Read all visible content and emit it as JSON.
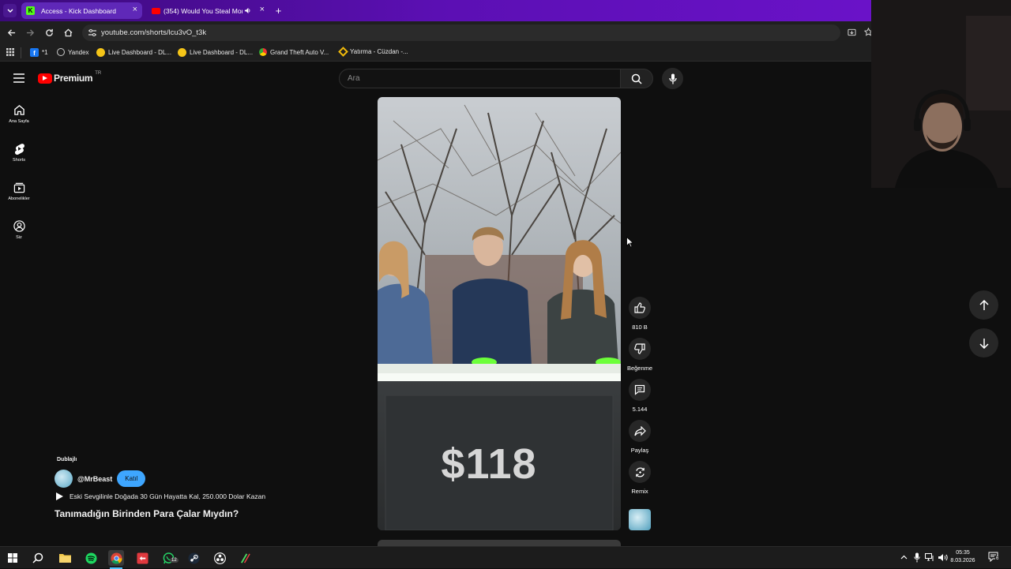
{
  "browser": {
    "tabs": [
      {
        "title": "Access - Kick Dashboard"
      },
      {
        "title": "(354) Would You Steal Mon"
      }
    ],
    "url": "youtube.com/shorts/lcu3vO_t3k",
    "bookmarks": [
      "*1",
      "Yandex",
      "Live Dashboard - DL...",
      "Live Dashboard - DL...",
      "Grand Theft Auto V...",
      "Yatırma - Cüzdan -..."
    ]
  },
  "youtube": {
    "logo": "Premium",
    "region": "TR",
    "search_placeholder": "Ara",
    "sidebar": [
      {
        "label": "Ana Sayfa",
        "icon": "home-icon"
      },
      {
        "label": "Shorts",
        "icon": "shorts-icon"
      },
      {
        "label": "Abonelikler",
        "icon": "subscriptions-icon"
      },
      {
        "label": "Siz",
        "icon": "account-icon"
      }
    ]
  },
  "short": {
    "badge": "Dublajlı",
    "channel": "@MrBeast",
    "join_label": "Katıl",
    "playlist": "Eski Sevgilinle Doğada 30 Gün Hayatta Kal, 250.000 Dolar Kazan",
    "title": "Tanımadığın Birinden Para Çalar Mıydın?",
    "video_amount": "$118",
    "actions": {
      "like_count": "810 B",
      "dislike_label": "Beğenme",
      "comments_count": "5.144",
      "share_label": "Paylaş",
      "remix_label": "Remix"
    }
  },
  "taskbar": {
    "time": "05:35",
    "date": "8.03.2026",
    "notifications": "6",
    "whatsapp_badge": "12"
  },
  "colors": {
    "youtube_red": "#ff0000",
    "join_button": "#3ea6ff",
    "tab_gradient": "#5b0fb3"
  }
}
